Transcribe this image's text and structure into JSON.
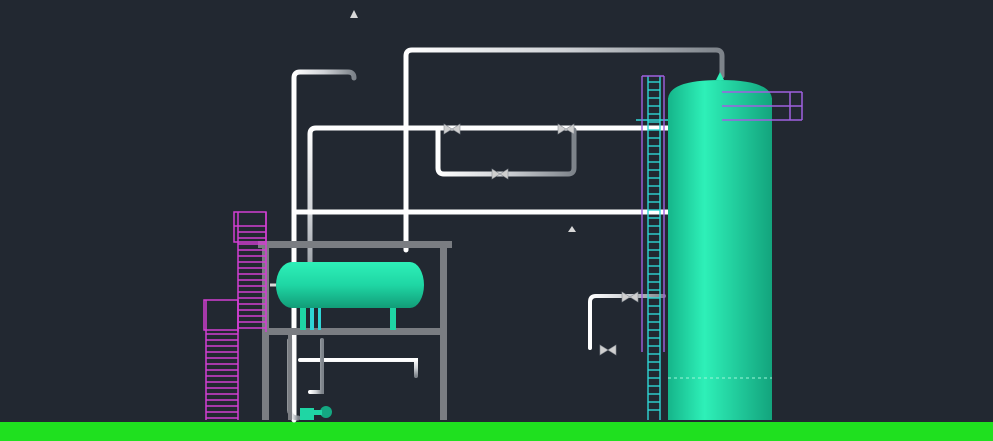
{
  "viewport": {
    "background": "#222831"
  },
  "colors": {
    "ground": "#1fe01f",
    "vessel": "#1fd6a4",
    "vessel_dark": "#14a882",
    "pipe": "#d8d8d8",
    "pipe_shadow": "#8a8f96",
    "frame": "#7a7d82",
    "stair": "#d23fd2",
    "ladder": "#2fd6d6",
    "platform_rail": "#a060e0",
    "valve": "#c9c9c9"
  },
  "drawing": {
    "objects": [
      "ground-slab",
      "vertical-column-vessel",
      "horizontal-drum-vessel",
      "steel-support-frame",
      "magenta-staircase",
      "cyan-ladder",
      "top-platform-railing",
      "piping-network",
      "pump-unit"
    ]
  }
}
